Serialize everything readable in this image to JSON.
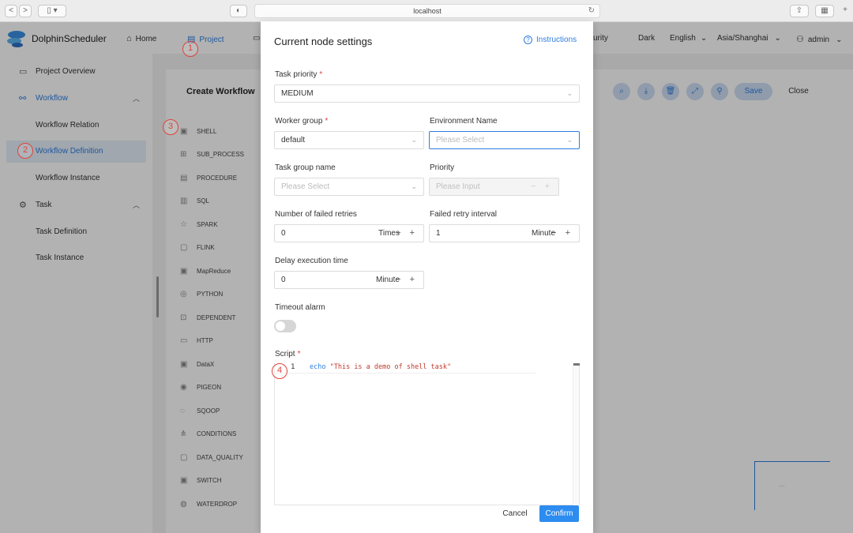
{
  "browser": {
    "url": "localhost",
    "back_icon": "<",
    "forward_icon": ">"
  },
  "app": {
    "name": "DolphinScheduler",
    "nav": [
      {
        "label": "Home",
        "icon": "home-icon"
      },
      {
        "label": "Project",
        "icon": "project-icon"
      },
      {
        "label": "urity",
        "icon": "security-icon"
      }
    ],
    "theme": "Dark",
    "language": "English",
    "timezone": "Asia/Shanghai",
    "user": "admin"
  },
  "sidebar": {
    "items": [
      {
        "label": "Project Overview"
      },
      {
        "label": "Workflow"
      },
      {
        "label": "Workflow Relation"
      },
      {
        "label": "Workflow Definition"
      },
      {
        "label": "Workflow Instance"
      },
      {
        "label": "Task"
      },
      {
        "label": "Task Definition"
      },
      {
        "label": "Task Instance"
      }
    ]
  },
  "editor_page": {
    "title": "Create Workflow",
    "tasks": [
      "SHELL",
      "SUB_PROCESS",
      "PROCEDURE",
      "SQL",
      "SPARK",
      "FLINK",
      "MapReduce",
      "PYTHON",
      "DEPENDENT",
      "HTTP",
      "DataX",
      "PIGEON",
      "SQOOP",
      "CONDITIONS",
      "DATA_QUALITY",
      "SWITCH",
      "WATERDROP"
    ],
    "save_label": "Save",
    "close_label": "Close",
    "minimap_text": "...."
  },
  "annotations": [
    "1",
    "2",
    "3",
    "4"
  ],
  "modal": {
    "title": "Current node settings",
    "instructions": "Instructions",
    "task_priority": {
      "label": "Task priority",
      "value": "MEDIUM"
    },
    "worker_group": {
      "label": "Worker group",
      "value": "default"
    },
    "environment_name": {
      "label": "Environment Name",
      "placeholder": "Please Select"
    },
    "task_group_name": {
      "label": "Task group name",
      "placeholder": "Please Select"
    },
    "priority": {
      "label": "Priority",
      "placeholder": "Please Input"
    },
    "failed_retries": {
      "label": "Number of failed retries",
      "value": "0",
      "unit": "Times"
    },
    "retry_interval": {
      "label": "Failed retry interval",
      "value": "1",
      "unit": "Minute"
    },
    "delay_time": {
      "label": "Delay execution time",
      "value": "0",
      "unit": "Minute"
    },
    "timeout_alarm": {
      "label": "Timeout alarm",
      "enabled": false
    },
    "script": {
      "label": "Script",
      "line_number": "1",
      "keyword": "echo",
      "string": "\"This is a demo of shell task\""
    },
    "required_mark": "*",
    "stepper": "− +",
    "cancel_label": "Cancel",
    "confirm_label": "Confirm"
  }
}
